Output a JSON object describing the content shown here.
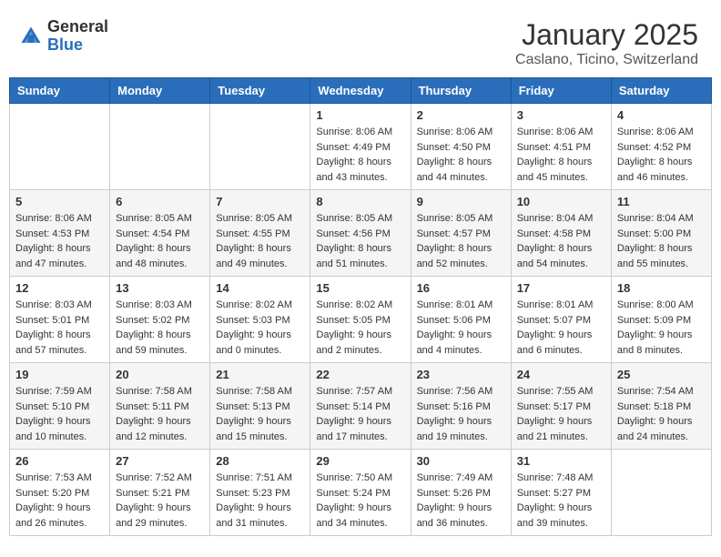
{
  "header": {
    "logo": {
      "general": "General",
      "blue": "Blue"
    },
    "title": "January 2025",
    "location": "Caslano, Ticino, Switzerland"
  },
  "days_of_week": [
    "Sunday",
    "Monday",
    "Tuesday",
    "Wednesday",
    "Thursday",
    "Friday",
    "Saturday"
  ],
  "weeks": [
    [
      {
        "day": null,
        "info": null
      },
      {
        "day": null,
        "info": null
      },
      {
        "day": null,
        "info": null
      },
      {
        "day": "1",
        "info": "Sunrise: 8:06 AM\nSunset: 4:49 PM\nDaylight: 8 hours\nand 43 minutes."
      },
      {
        "day": "2",
        "info": "Sunrise: 8:06 AM\nSunset: 4:50 PM\nDaylight: 8 hours\nand 44 minutes."
      },
      {
        "day": "3",
        "info": "Sunrise: 8:06 AM\nSunset: 4:51 PM\nDaylight: 8 hours\nand 45 minutes."
      },
      {
        "day": "4",
        "info": "Sunrise: 8:06 AM\nSunset: 4:52 PM\nDaylight: 8 hours\nand 46 minutes."
      }
    ],
    [
      {
        "day": "5",
        "info": "Sunrise: 8:06 AM\nSunset: 4:53 PM\nDaylight: 8 hours\nand 47 minutes."
      },
      {
        "day": "6",
        "info": "Sunrise: 8:05 AM\nSunset: 4:54 PM\nDaylight: 8 hours\nand 48 minutes."
      },
      {
        "day": "7",
        "info": "Sunrise: 8:05 AM\nSunset: 4:55 PM\nDaylight: 8 hours\nand 49 minutes."
      },
      {
        "day": "8",
        "info": "Sunrise: 8:05 AM\nSunset: 4:56 PM\nDaylight: 8 hours\nand 51 minutes."
      },
      {
        "day": "9",
        "info": "Sunrise: 8:05 AM\nSunset: 4:57 PM\nDaylight: 8 hours\nand 52 minutes."
      },
      {
        "day": "10",
        "info": "Sunrise: 8:04 AM\nSunset: 4:58 PM\nDaylight: 8 hours\nand 54 minutes."
      },
      {
        "day": "11",
        "info": "Sunrise: 8:04 AM\nSunset: 5:00 PM\nDaylight: 8 hours\nand 55 minutes."
      }
    ],
    [
      {
        "day": "12",
        "info": "Sunrise: 8:03 AM\nSunset: 5:01 PM\nDaylight: 8 hours\nand 57 minutes."
      },
      {
        "day": "13",
        "info": "Sunrise: 8:03 AM\nSunset: 5:02 PM\nDaylight: 8 hours\nand 59 minutes."
      },
      {
        "day": "14",
        "info": "Sunrise: 8:02 AM\nSunset: 5:03 PM\nDaylight: 9 hours\nand 0 minutes."
      },
      {
        "day": "15",
        "info": "Sunrise: 8:02 AM\nSunset: 5:05 PM\nDaylight: 9 hours\nand 2 minutes."
      },
      {
        "day": "16",
        "info": "Sunrise: 8:01 AM\nSunset: 5:06 PM\nDaylight: 9 hours\nand 4 minutes."
      },
      {
        "day": "17",
        "info": "Sunrise: 8:01 AM\nSunset: 5:07 PM\nDaylight: 9 hours\nand 6 minutes."
      },
      {
        "day": "18",
        "info": "Sunrise: 8:00 AM\nSunset: 5:09 PM\nDaylight: 9 hours\nand 8 minutes."
      }
    ],
    [
      {
        "day": "19",
        "info": "Sunrise: 7:59 AM\nSunset: 5:10 PM\nDaylight: 9 hours\nand 10 minutes."
      },
      {
        "day": "20",
        "info": "Sunrise: 7:58 AM\nSunset: 5:11 PM\nDaylight: 9 hours\nand 12 minutes."
      },
      {
        "day": "21",
        "info": "Sunrise: 7:58 AM\nSunset: 5:13 PM\nDaylight: 9 hours\nand 15 minutes."
      },
      {
        "day": "22",
        "info": "Sunrise: 7:57 AM\nSunset: 5:14 PM\nDaylight: 9 hours\nand 17 minutes."
      },
      {
        "day": "23",
        "info": "Sunrise: 7:56 AM\nSunset: 5:16 PM\nDaylight: 9 hours\nand 19 minutes."
      },
      {
        "day": "24",
        "info": "Sunrise: 7:55 AM\nSunset: 5:17 PM\nDaylight: 9 hours\nand 21 minutes."
      },
      {
        "day": "25",
        "info": "Sunrise: 7:54 AM\nSunset: 5:18 PM\nDaylight: 9 hours\nand 24 minutes."
      }
    ],
    [
      {
        "day": "26",
        "info": "Sunrise: 7:53 AM\nSunset: 5:20 PM\nDaylight: 9 hours\nand 26 minutes."
      },
      {
        "day": "27",
        "info": "Sunrise: 7:52 AM\nSunset: 5:21 PM\nDaylight: 9 hours\nand 29 minutes."
      },
      {
        "day": "28",
        "info": "Sunrise: 7:51 AM\nSunset: 5:23 PM\nDaylight: 9 hours\nand 31 minutes."
      },
      {
        "day": "29",
        "info": "Sunrise: 7:50 AM\nSunset: 5:24 PM\nDaylight: 9 hours\nand 34 minutes."
      },
      {
        "day": "30",
        "info": "Sunrise: 7:49 AM\nSunset: 5:26 PM\nDaylight: 9 hours\nand 36 minutes."
      },
      {
        "day": "31",
        "info": "Sunrise: 7:48 AM\nSunset: 5:27 PM\nDaylight: 9 hours\nand 39 minutes."
      },
      {
        "day": null,
        "info": null
      }
    ]
  ]
}
